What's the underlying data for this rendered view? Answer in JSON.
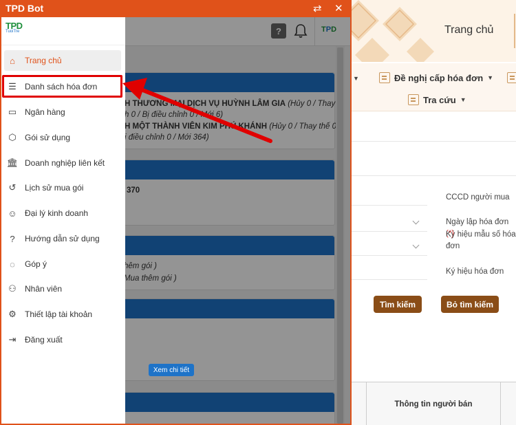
{
  "window": {
    "title": "TPD Bot"
  },
  "background_page": {
    "title": "Trang chủ",
    "menu": [
      {
        "label": "Đề nghị cấp hóa đơn"
      },
      {
        "label": "Tra cứu"
      }
    ],
    "fields": {
      "cccd": "CCCD người mua",
      "ngay_lap": "Ngày lập hóa đơn",
      "ngay_lap_req": "(*)",
      "ky_hieu_mau": "Ký hiệu mẫu số hóa đơn",
      "ky_hieu": "Ký hiệu hóa đơn"
    },
    "buttons": {
      "search": "Tìm kiếm",
      "clear": "Bỏ tìm kiếm"
    },
    "table": {
      "seller_col": "Thông tin người bán"
    }
  },
  "content": {
    "card1_line1": "H THƯƠNG MẠI DỊCH VỤ HUỲNH LÂM GIA",
    "card1_line1_tail": "(Hủy 0 / Thay",
    "card1_line2": "h 0 / Bị điều chỉnh 0 / Mới 6)",
    "card1_line3": "H MỘT THÀNH VIÊN KIM PHÚ KHÁNH",
    "card1_line3_tail": "(Hủy 0 / Thay thế 0 /",
    "card1_line4": "ị điều chỉnh 0 / Mới 364)",
    "card2_value": "370",
    "card3_line1": "hêm gói )",
    "card3_line2": "Mua thêm gói )",
    "detail_button": "Xem chi tiết"
  },
  "sidebar": {
    "logo_text": "TPD",
    "logo_sub": "TuoiTre",
    "items": [
      {
        "label": "Trang chủ",
        "icon": "home-icon",
        "active": true
      },
      {
        "label": "Danh sách hóa đơn",
        "icon": "list-icon",
        "active": false
      },
      {
        "label": "Ngân hàng",
        "icon": "bank-card-icon",
        "active": false
      },
      {
        "label": "Gói sử dụng",
        "icon": "package-icon",
        "active": false
      },
      {
        "label": "Doanh nghiệp liên kết",
        "icon": "institution-icon",
        "active": false
      },
      {
        "label": "Lịch sử mua gói",
        "icon": "history-icon",
        "active": false
      },
      {
        "label": "Đại lý kinh doanh",
        "icon": "agent-icon",
        "active": false
      },
      {
        "label": "Hướng dẫn sử dụng",
        "icon": "guide-icon",
        "active": false
      },
      {
        "label": "Góp ý",
        "icon": "feedback-icon",
        "active": false
      },
      {
        "label": "Nhân viên",
        "icon": "staff-icon",
        "active": false
      },
      {
        "label": "Thiết lập tài khoản",
        "icon": "settings-icon",
        "active": false
      },
      {
        "label": "Đăng xuất",
        "icon": "logout-icon",
        "active": false
      }
    ]
  },
  "colors": {
    "accent": "#e0521a",
    "highlight": "#e00000",
    "card_header": "#1e73c8",
    "button_brown": "#8a4d17"
  }
}
